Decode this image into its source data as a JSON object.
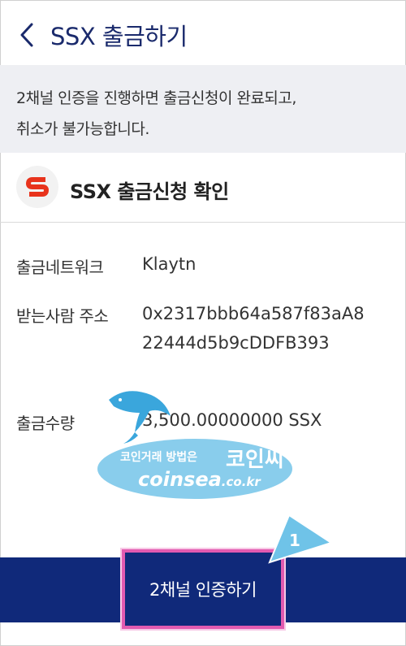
{
  "header": {
    "title": "SSX 출금하기",
    "back_icon": "chevron-left-icon"
  },
  "notice": {
    "line1": "2채널 인증을 진행하면 출금신청이 완료되고,",
    "line2": "취소가 불가능합니다."
  },
  "confirm": {
    "title": "SSX 출금신청 확인",
    "logo_letter": "S"
  },
  "details": {
    "network_label": "출금네트워크",
    "network_value": "Klaytn",
    "address_label": "받는사람 주소",
    "address_line1": "0x2317bbb64a587f83aA8",
    "address_line2": "22444d5b9cDDFB393",
    "amount_label": "출금수량",
    "amount_value": "3,500.00000000 SSX"
  },
  "action": {
    "submit_label": "2채널 인증하기"
  },
  "annotation": {
    "step": "1"
  },
  "watermark": {
    "line1": "코인거래 방법은",
    "brand": "코인씨",
    "site": "coinsea",
    "domain": ".co.kr"
  },
  "colors": {
    "navy": "#10297a",
    "title": "#1a2a6c",
    "notice_bg": "#eeeff3",
    "highlight": "#e25ab0",
    "logo_red": "#e8331c"
  }
}
